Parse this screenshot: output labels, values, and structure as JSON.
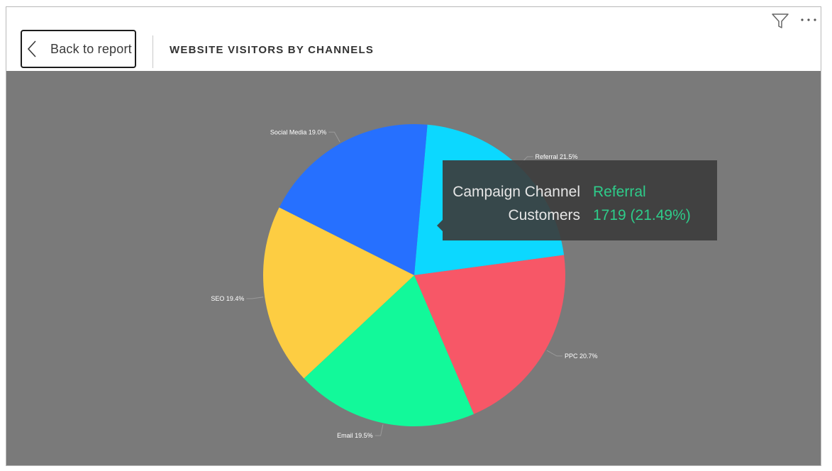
{
  "header": {
    "back_label": "Back to report",
    "page_title": "WEBSITE VISITORS BY CHANNELS"
  },
  "icons": {
    "back": "chevron-left-icon",
    "filter": "filter-icon",
    "more": "more-options-icon"
  },
  "colors": {
    "canvas_bg": "#7a7a7a",
    "tooltip_value": "#2ecc8a"
  },
  "tooltip": {
    "rows": [
      {
        "key": "Campaign Channel",
        "value": "Referral"
      },
      {
        "key": "Customers",
        "value": "1719 (21.49%)"
      }
    ]
  },
  "chart_data": {
    "type": "pie",
    "categories": [
      "Referral",
      "PPC",
      "Email",
      "SEO",
      "Social Media"
    ],
    "values": [
      21.5,
      20.7,
      19.5,
      19.4,
      19.0
    ],
    "labels": [
      "Referral 21.5%",
      "PPC 20.7%",
      "Email 19.5%",
      "SEO 19.4%",
      "Social Media 19.0%"
    ],
    "colors": [
      "#0cd8ff",
      "#f75767",
      "#12f99a",
      "#fdcd42",
      "#2670ff"
    ],
    "title": "WEBSITE VISITORS BY CHANNELS"
  }
}
